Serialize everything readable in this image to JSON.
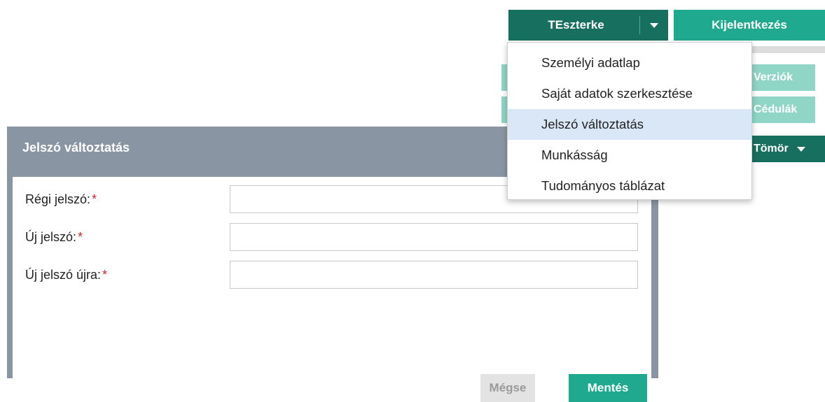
{
  "header": {
    "user_label": "TEszterke",
    "logout_label": "Kijelentkezés"
  },
  "user_menu": {
    "items": [
      {
        "label": "Személyi adatlap",
        "active": false
      },
      {
        "label": "Saját adatok szerkesztése",
        "active": false
      },
      {
        "label": "Jelszó változtatás",
        "active": true
      },
      {
        "label": "Munkásság",
        "active": false
      },
      {
        "label": "Tudományos táblázat",
        "active": false
      }
    ]
  },
  "side_nav": {
    "versions_label": "Verziók",
    "notes_label": "Cédulák",
    "compact_label": "Tömör"
  },
  "dialog": {
    "title": "Jelszó változtatás",
    "fields": [
      {
        "label": "Régi jelszó:",
        "required_mark": "*",
        "value": ""
      },
      {
        "label": "Új jelszó:",
        "required_mark": "*",
        "value": ""
      },
      {
        "label": "Új jelszó újra:",
        "required_mark": "*",
        "value": ""
      }
    ],
    "cancel_label": "Mégse",
    "save_label": "Mentés"
  },
  "colors": {
    "dark_teal": "#17705f",
    "teal": "#1fa98f",
    "light_teal": "#8fd6c6",
    "dialog_header": "#8a95a3",
    "required": "#d9232d",
    "menu_highlight": "#d9e7f6"
  }
}
